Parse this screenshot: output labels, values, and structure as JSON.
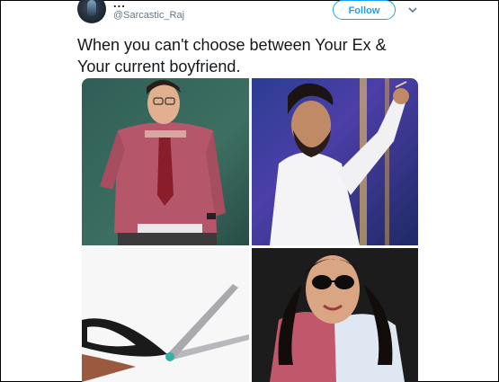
{
  "tweet": {
    "display_name": "...",
    "handle": "@Sarcastic_Raj",
    "follow_label": "Follow",
    "text": "When you can't choose between Your Ex & Your current boyfriend."
  },
  "colors": {
    "accent": "#1da1f2",
    "text_primary": "#14171a",
    "text_secondary": "#657786"
  },
  "icons": {
    "avatar": "profile-avatar",
    "menu": "chevron-down-icon"
  },
  "media": {
    "tiles": [
      "photo-man-checked-shirt",
      "photo-man-white-shirt",
      "photo-scissors",
      "photo-woman-sunglasses"
    ]
  }
}
